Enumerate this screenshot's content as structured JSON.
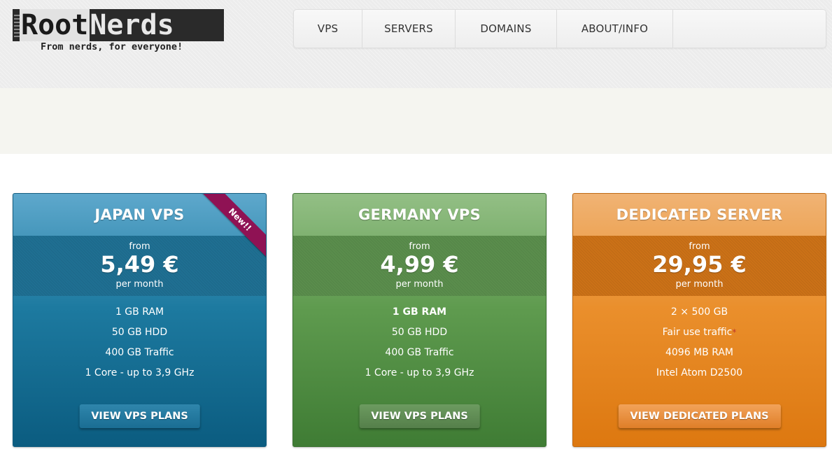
{
  "logo": {
    "part1": "Root",
    "part2": "Nerds",
    "tagline": "From nerds, for everyone!"
  },
  "nav": {
    "items": [
      {
        "label": "VPS"
      },
      {
        "label": "SERVERS"
      },
      {
        "label": "DOMAINS"
      },
      {
        "label": "ABOUT/INFO"
      }
    ]
  },
  "cards": [
    {
      "title": "JAPAN VPS",
      "ribbon": "New!!",
      "from_label": "from",
      "price": "5,49 €",
      "period": "per month",
      "features": [
        "1 GB RAM",
        "50 GB HDD",
        "400 GB Traffic",
        "1 Core - up to 3,9 GHz"
      ],
      "button": "VIEW VPS PLANS",
      "color": "#1d7aa0"
    },
    {
      "title": "GERMANY VPS",
      "from_label": "from",
      "price": "4,99 €",
      "period": "per month",
      "features": [
        "1 GB RAM",
        "50 GB HDD",
        "400 GB Traffic",
        "1 Core - up to 3,9 GHz"
      ],
      "button": "VIEW VPS PLANS",
      "color": "#5f9b4f"
    },
    {
      "title": "DEDICATED SERVER",
      "from_label": "from",
      "price": "29,95 €",
      "period": "per month",
      "features": [
        "2 × 500 GB",
        "Fair use traffic",
        "4096 MB RAM",
        "Intel Atom D2500"
      ],
      "features_note_marker": "*",
      "button": "VIEW DEDICATED PLANS",
      "color": "#ea8f2c"
    }
  ]
}
